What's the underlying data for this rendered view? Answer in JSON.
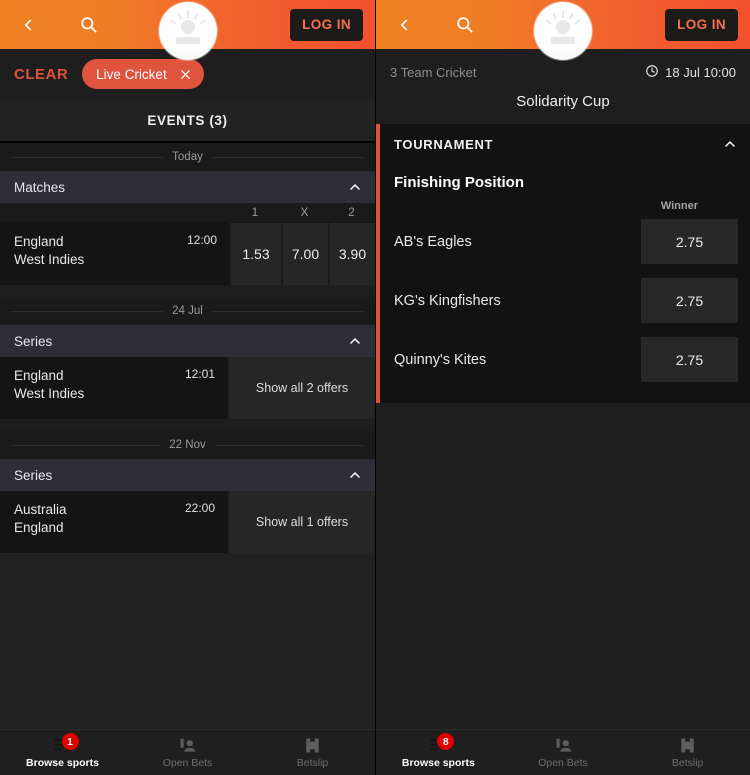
{
  "topbar": {
    "back_icon": "chevron-left-icon",
    "search_icon": "search-icon",
    "logo_icon": "brand-logo-icon",
    "login_label": "LOG IN"
  },
  "left": {
    "filters": {
      "clear_label": "CLEAR",
      "chip_label": "Live Cricket",
      "chip_close_icon": "close-icon"
    },
    "events_header": "EVENTS (3)",
    "groups": [
      {
        "date": "Today",
        "section_title": "Matches",
        "collapse_icon": "chevron-up-icon",
        "column_labels": [
          "1",
          "X",
          "2"
        ],
        "events": [
          {
            "home": "England",
            "away": "West Indies",
            "time": "12:00",
            "odds": [
              "1.53",
              "7.00",
              "3.90"
            ],
            "offers_label": null
          }
        ]
      },
      {
        "date": "24 Jul",
        "section_title": "Series",
        "collapse_icon": "chevron-up-icon",
        "column_labels": [],
        "events": [
          {
            "home": "England",
            "away": "West Indies",
            "time": "12:01",
            "odds": [],
            "offers_label": "Show all 2 offers"
          }
        ]
      },
      {
        "date": "22 Nov",
        "section_title": "Series",
        "collapse_icon": "chevron-up-icon",
        "column_labels": [],
        "events": [
          {
            "home": "Australia",
            "away": "England",
            "time": "22:00",
            "odds": [],
            "offers_label": "Show all 1 offers"
          }
        ]
      }
    ]
  },
  "right": {
    "sport": "3 Team Cricket",
    "clock_icon": "clock-icon",
    "start_time": "18 Jul 10:00",
    "event_title": "Solidarity Cup",
    "market": {
      "header": "TOURNAMENT",
      "collapse_icon": "chevron-up-icon",
      "name": "Finishing Position",
      "column_label": "Winner",
      "accent_color": "#e0523c",
      "selections": [
        {
          "name": "AB's Eagles",
          "odd": "2.75"
        },
        {
          "name": "KG's Kingfishers",
          "odd": "2.75"
        },
        {
          "name": "Quinny's Kites",
          "odd": "2.75"
        }
      ]
    }
  },
  "bottom_nav_left": {
    "items": [
      {
        "label": "Browse sports",
        "icon": "browse-sports-icon",
        "badge": "1",
        "active": true
      },
      {
        "label": "Open Bets",
        "icon": "open-bets-icon",
        "badge": null,
        "active": false
      },
      {
        "label": "Betslip",
        "icon": "betslip-icon",
        "badge": null,
        "active": false
      }
    ]
  },
  "bottom_nav_right": {
    "items": [
      {
        "label": "Browse sports",
        "icon": "browse-sports-icon",
        "badge": "8",
        "active": true
      },
      {
        "label": "Open Bets",
        "icon": "open-bets-icon",
        "badge": null,
        "active": false
      },
      {
        "label": "Betslip",
        "icon": "betslip-icon",
        "badge": null,
        "active": false
      }
    ]
  }
}
